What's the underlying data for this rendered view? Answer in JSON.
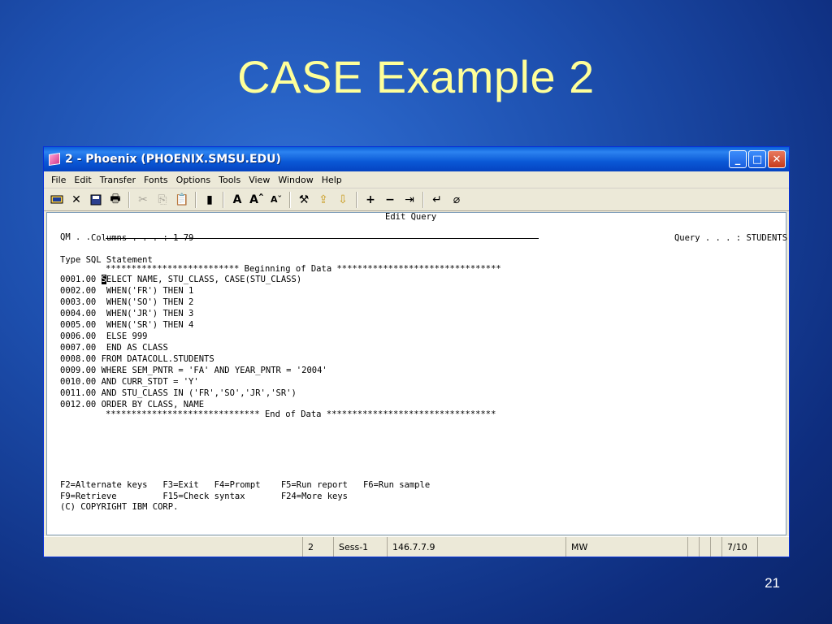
{
  "slide": {
    "title": "CASE Example 2",
    "page_number": "21"
  },
  "window": {
    "title": "2 - Phoenix (PHOENIX.SMSU.EDU)",
    "buttons": {
      "minimize": "_",
      "maximize": "□",
      "close": "✕"
    }
  },
  "menu": [
    "File",
    "Edit",
    "Transfer",
    "Fonts",
    "Options",
    "Tools",
    "View",
    "Window",
    "Help"
  ],
  "toolbar_icons": [
    "session-icon",
    "disconnect-icon",
    "save-icon",
    "print-icon",
    "cut-icon",
    "copy-icon",
    "paste-icon",
    "keypad-icon",
    "font-size-icon",
    "font-larger-icon",
    "font-smaller-icon",
    "macro-icon",
    "send-file-icon",
    "receive-file-icon",
    "plus-icon",
    "minus-icon",
    "tab-icon",
    "enter-icon",
    "clear-icon"
  ],
  "screen": {
    "header": "Edit Query",
    "columns_label": "Columns . . . :",
    "columns_value": "1 79",
    "query_label": "Query . . . :",
    "query_value": "STUDENTS",
    "qm_label": "QM . .",
    "section_label": "Type SQL Statement",
    "beginning_marker": "************************** Beginning of Data ********************************",
    "lines": [
      {
        "num": "0001.00",
        "cursor_char": "S",
        "code": "ELECT NAME, STU_CLASS, CASE(STU_CLASS)"
      },
      {
        "num": "0002.00",
        "code": " WHEN('FR') THEN 1"
      },
      {
        "num": "0003.00",
        "code": " WHEN('SO') THEN 2"
      },
      {
        "num": "0004.00",
        "code": " WHEN('JR') THEN 3"
      },
      {
        "num": "0005.00",
        "code": " WHEN('SR') THEN 4"
      },
      {
        "num": "0006.00",
        "code": " ELSE 999"
      },
      {
        "num": "0007.00",
        "code": " END AS CLASS"
      },
      {
        "num": "0008.00",
        "code": "FROM DATACOLL.STUDENTS"
      },
      {
        "num": "0009.00",
        "code": "WHERE SEM_PNTR = 'FA' AND YEAR_PNTR = '2004'"
      },
      {
        "num": "0010.00",
        "code": "AND CURR_STDT = 'Y'"
      },
      {
        "num": "0011.00",
        "code": "AND STU_CLASS IN ('FR','SO','JR','SR')"
      },
      {
        "num": "0012.00",
        "code": "ORDER BY CLASS, NAME"
      }
    ],
    "end_marker": "****************************** End of Data *********************************",
    "fkeys_line1": "F2=Alternate keys   F3=Exit   F4=Prompt    F5=Run report   F6=Run sample",
    "fkeys_line2": "F9=Retrieve         F15=Check syntax       F24=More keys",
    "copyright": "(C) COPYRIGHT IBM CORP."
  },
  "status": {
    "session_num": "2",
    "session_name": "Sess-1",
    "host_ip": "146.7.7.9",
    "mode": "MW",
    "position": "7/10"
  }
}
